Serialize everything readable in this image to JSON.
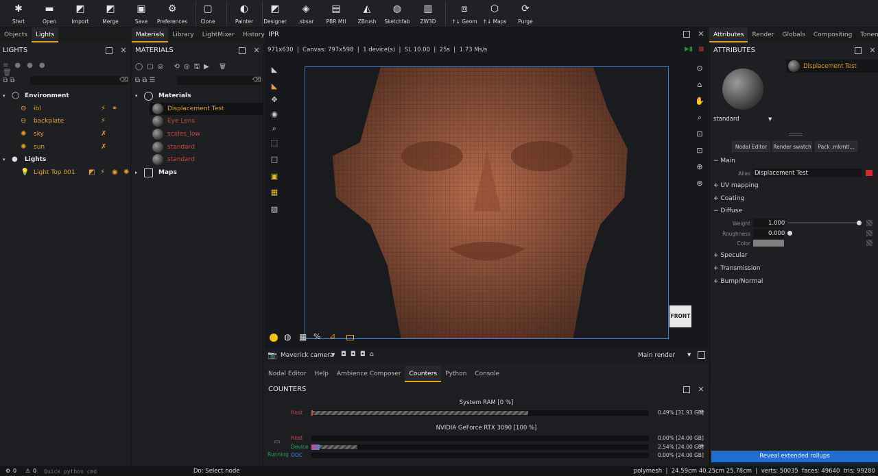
{
  "toolbar": {
    "items": [
      {
        "label": "Start",
        "icon": "start-icon"
      },
      {
        "label": "Open",
        "icon": "folder-icon"
      },
      {
        "label": "Import",
        "icon": "import-icon"
      },
      {
        "label": "Merge",
        "icon": "merge-icon"
      },
      {
        "label": "Save",
        "icon": "save-icon"
      },
      {
        "label": "Preferences",
        "icon": "gear-icon"
      },
      {
        "label": "Clone",
        "icon": "clone-icon"
      },
      {
        "label": "Painter",
        "icon": "painter-icon"
      },
      {
        "label": "Designer",
        "icon": "designer-icon"
      },
      {
        "label": ".sbsar",
        "icon": "sbsar-icon"
      },
      {
        "label": "PBR Mtl",
        "icon": "pbr-icon"
      },
      {
        "label": "ZBrush",
        "icon": "zbrush-icon"
      },
      {
        "label": "Sketchfab",
        "icon": "sketchfab-icon"
      },
      {
        "label": "ZW3D",
        "icon": "zw3d-icon"
      },
      {
        "label": "↑↓ Geom",
        "icon": "geom-icon"
      },
      {
        "label": "↑↓ Maps",
        "icon": "maps-icon"
      },
      {
        "label": "Purge",
        "icon": "purge-icon"
      }
    ]
  },
  "left_panel": {
    "tabs": [
      "Objects",
      "Lights"
    ],
    "title": "LIGHTS",
    "tree": [
      {
        "label": "Environment",
        "level": 0,
        "kind": "group"
      },
      {
        "label": "ibl",
        "level": 1
      },
      {
        "label": "backplate",
        "level": 1
      },
      {
        "label": "sky",
        "level": 1
      },
      {
        "label": "sun",
        "level": 1
      },
      {
        "label": "Lights",
        "level": 0,
        "kind": "group"
      },
      {
        "label": "Light Top 001",
        "level": 1
      }
    ]
  },
  "materials_panel": {
    "tabs": [
      "Materials",
      "Library",
      "LightMixer",
      "History"
    ],
    "title": "MATERIALS",
    "root": "Materials",
    "items": [
      {
        "label": "Displacement Test",
        "color": "#e8a030"
      },
      {
        "label": "Eye Lens",
        "color": "#c8473a"
      },
      {
        "label": "scales_low",
        "color": "#c8473a"
      },
      {
        "label": "standard",
        "color": "#c8473a"
      },
      {
        "label": "standard",
        "color": "#c8473a"
      }
    ],
    "maps": "Maps"
  },
  "viewport": {
    "title": "IPR",
    "info": "971x630  |  Canvas: 797x598  |  1 device(s)  |  SL 10.00  |  25s  |  1.73 Ms/s",
    "camera": "Maverick camera",
    "render": "Main render",
    "cube_label": "FRONT"
  },
  "bottom_tabs": [
    "Nodal Editor",
    "Help",
    "Ambience Composer",
    "Counters",
    "Python",
    "Console"
  ],
  "counters": {
    "title": "COUNTERS",
    "ram_title": "System RAM  [0 %]",
    "ram_host_label": "Host",
    "ram_host_value": "0.49% [31.93 GB]",
    "ram_fill": 0.49,
    "gpu_title": "NVIDIA GeForce RTX 3090  [100 %]",
    "gpu_rows": [
      {
        "label": "Host",
        "value": "0.00% [24.00 GB]",
        "fill": 0.0
      },
      {
        "label": "Device",
        "value": "2.54% [24.00 GB]",
        "fill": 0.0254
      },
      {
        "label": "OOC",
        "value": "0.00% [24.00 GB]",
        "fill": 0.0
      }
    ],
    "running": "Running"
  },
  "attributes": {
    "tabs": [
      "Attributes",
      "Render",
      "Globals",
      "Compositing",
      "Tonemap"
    ],
    "title": "ATTRIBUTES",
    "material_name": "Displacement Test",
    "material_type": "standard",
    "buttons": [
      "Nodal Editor",
      "Render swatch",
      "Pack .mkmtl..."
    ],
    "main": "Main",
    "alias_label": "Alias",
    "alias_value": "Displacement Test",
    "sections_collapsed_1": [
      "UV mapping",
      "Coating"
    ],
    "diffuse": "Diffuse",
    "weight_label": "Weight",
    "weight_value": "1.000",
    "roughness_label": "Roughness",
    "roughness_value": "0.000",
    "color_label": "Color",
    "sections_collapsed_2": [
      "Specular",
      "Transmission",
      "Bump/Normal"
    ],
    "reveal_btn": "Reveal extended rollups"
  },
  "status": {
    "errors": "0",
    "warnings": "0",
    "python_placeholder": "Quick python cmd",
    "do_text": "Do: Select node",
    "right": "polymesh  |  24.59cm 40.25cm 25.78cm  |  verts: 50035  faces: 49640  tris: 99280"
  }
}
